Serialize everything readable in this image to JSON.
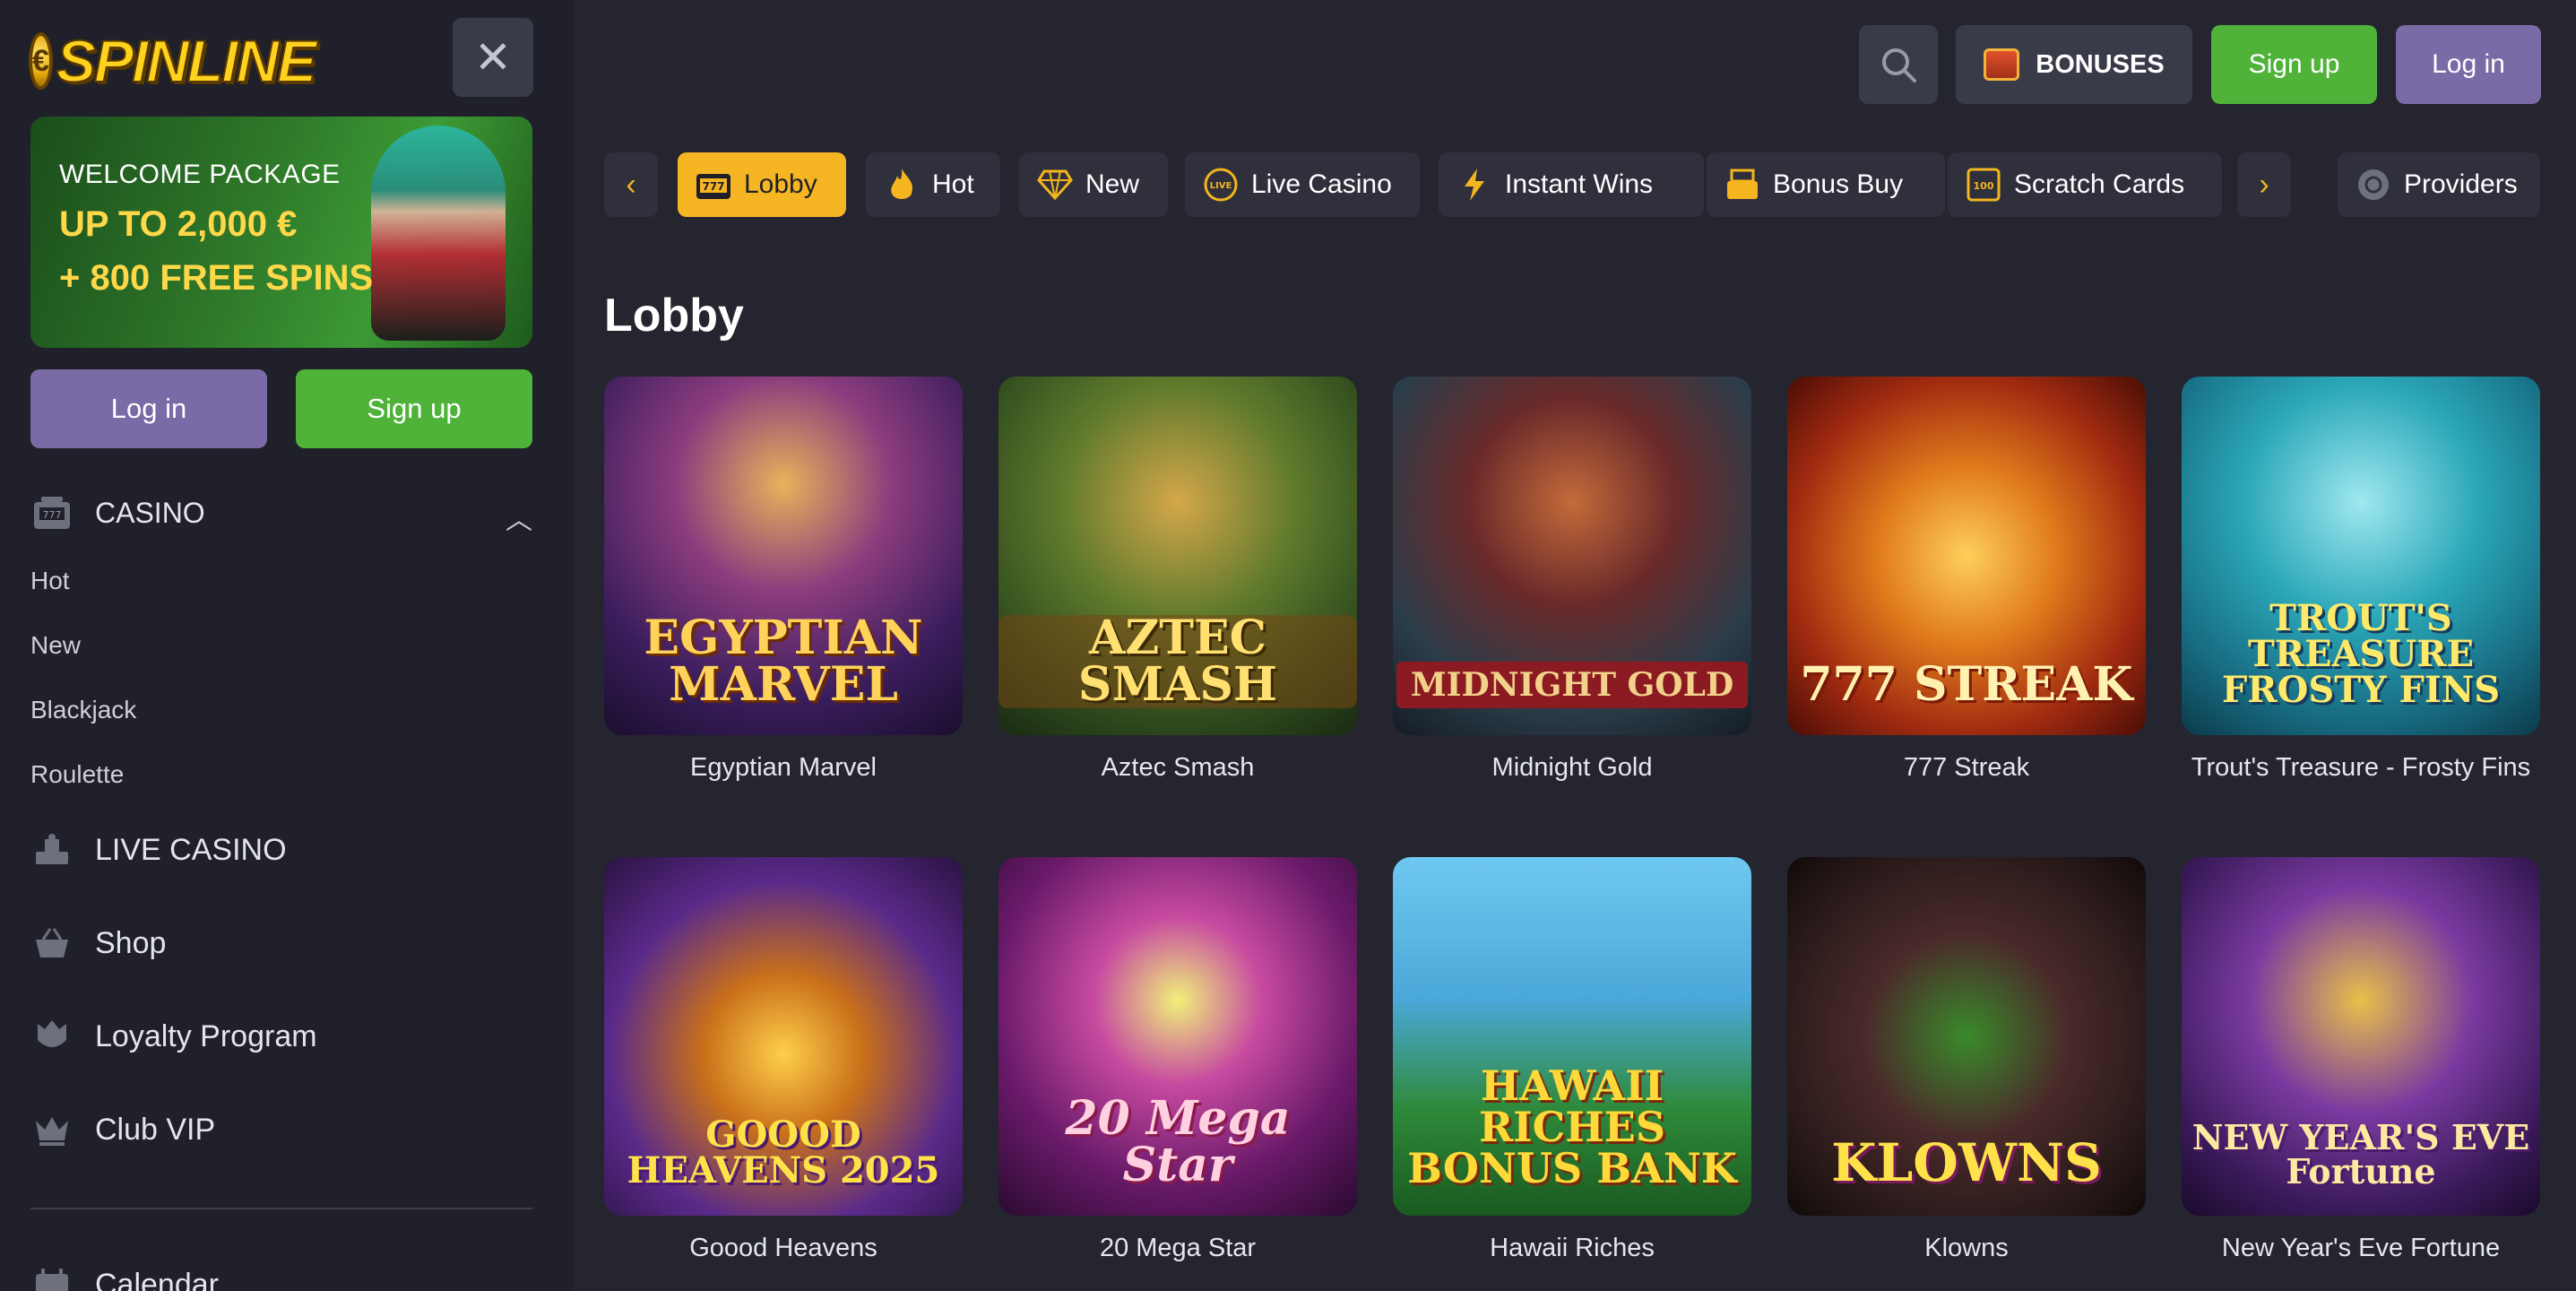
{
  "brand": {
    "logo_text": "SPINLINE"
  },
  "sidebar": {
    "promo": {
      "line1": "WELCOME PACKAGE",
      "line2": "UP TO 2,000 €",
      "line3": "+ 800 FREE SPINS"
    },
    "login_label": "Log in",
    "signup_label": "Sign up",
    "casino": {
      "label": "CASINO",
      "items": [
        "Hot",
        "New",
        "Blackjack",
        "Roulette"
      ]
    },
    "nav": [
      {
        "label": "LIVE CASINO",
        "icon": "live-casino-icon"
      },
      {
        "label": "Shop",
        "icon": "basket-icon"
      },
      {
        "label": "Loyalty Program",
        "icon": "crown-shield-icon"
      },
      {
        "label": "Club VIP",
        "icon": "crown-icon"
      }
    ],
    "cut_off_item": "Calendar"
  },
  "topbar": {
    "bonuses_label": "BONUSES",
    "signup_label": "Sign up",
    "login_label": "Log in"
  },
  "categories": [
    {
      "label": "Lobby",
      "icon": "slot-777-icon",
      "active": true
    },
    {
      "label": "Hot",
      "icon": "flame-icon"
    },
    {
      "label": "New",
      "icon": "diamond-icon"
    },
    {
      "label": "Live Casino",
      "icon": "live-badge-icon"
    },
    {
      "label": "Instant Wins",
      "icon": "lightning-icon"
    },
    {
      "label": "Bonus Buy",
      "icon": "cash-register-icon"
    },
    {
      "label": "Scratch Cards",
      "icon": "scratch-card-icon"
    }
  ],
  "providers_label": "Providers",
  "section_title": "Lobby",
  "games": [
    {
      "name": "Egyptian Marvel",
      "art_title": "EGYPTIAN MARVEL"
    },
    {
      "name": "Aztec Smash",
      "art_title": "AZTEC SMASH"
    },
    {
      "name": "Midnight Gold",
      "art_title": "MIDNIGHT GOLD"
    },
    {
      "name": "777 Streak",
      "art_title": "777 STREAK"
    },
    {
      "name": "Trout's Treasure - Frosty Fins",
      "art_title": "TROUT'S TREASURE FROSTY FINS"
    },
    {
      "name": "Goood Heavens",
      "art_title": "GOOOD HEAVENS 2025"
    },
    {
      "name": "20 Mega Star",
      "art_title": "20 Mega Star"
    },
    {
      "name": "Hawaii Riches",
      "art_title": "HAWAII RICHES BONUS BANK"
    },
    {
      "name": "Klowns",
      "art_title": "KLOWNS"
    },
    {
      "name": "New Year's Eve Fortune",
      "art_title": "NEW YEAR'S EVE Fortune"
    }
  ],
  "colors": {
    "accent_yellow": "#f6b624",
    "signup_green": "#4fb33a",
    "login_purple": "#7a6aa6",
    "bg": "#24252f",
    "sidebar_bg": "#1f2029"
  }
}
